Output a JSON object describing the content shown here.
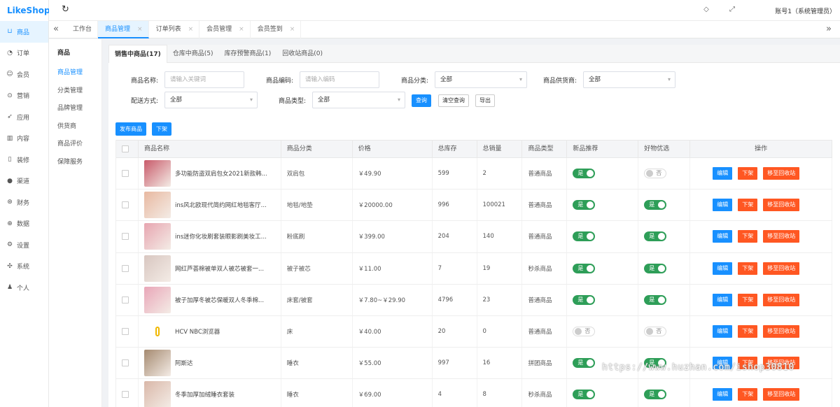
{
  "app": {
    "logo": "LikeShop"
  },
  "topbar": {
    "account": "账号1（系统管理员）"
  },
  "nav": [
    {
      "label": "商品",
      "icon": "cart-icon",
      "active": true
    },
    {
      "label": "订单",
      "icon": "bell-icon"
    },
    {
      "label": "会员",
      "icon": "user-icon"
    },
    {
      "label": "营销",
      "icon": "marketing-icon"
    },
    {
      "label": "应用",
      "icon": "send-icon"
    },
    {
      "label": "内容",
      "icon": "book-icon"
    },
    {
      "label": "装修",
      "icon": "phone-icon"
    },
    {
      "label": "渠道",
      "icon": "channel-icon"
    },
    {
      "label": "财务",
      "icon": "finance-icon"
    },
    {
      "label": "数据",
      "icon": "data-icon"
    },
    {
      "label": "设置",
      "icon": "settings-icon"
    },
    {
      "label": "系统",
      "icon": "system-icon"
    },
    {
      "label": "个人",
      "icon": "person-icon"
    }
  ],
  "tabs": [
    {
      "label": "工作台",
      "closable": false
    },
    {
      "label": "商品管理",
      "closable": true,
      "active": true
    },
    {
      "label": "订单列表",
      "closable": true
    },
    {
      "label": "会员管理",
      "closable": true
    },
    {
      "label": "会员签到",
      "closable": true
    }
  ],
  "subnav": {
    "title": "商品",
    "items": [
      "商品管理",
      "分类管理",
      "品牌管理",
      "供货商",
      "商品评价",
      "保障服务"
    ]
  },
  "content_tabs": [
    "销售中商品(17)",
    "仓库中商品(5)",
    "库存预警商品(1)",
    "回收站商品(0)"
  ],
  "filters": {
    "name_label": "商品名称:",
    "name_placeholder": "请输入关键词",
    "code_label": "商品编码:",
    "code_placeholder": "请输入编码",
    "category_label": "商品分类:",
    "category_value": "全部",
    "supplier_label": "商品供货商:",
    "supplier_value": "全部",
    "delivery_label": "配送方式:",
    "delivery_value": "全部",
    "type_label": "商品类型:",
    "type_value": "全部",
    "search_btn": "查询",
    "clear_btn": "清空查询",
    "export_btn": "导出"
  },
  "actions": {
    "publish": "发布商品",
    "offshelf": "下架"
  },
  "table": {
    "headers": [
      "商品名称",
      "商品分类",
      "价格",
      "总库存",
      "总销量",
      "商品类型",
      "新品推荐",
      "好物优选",
      "操作"
    ],
    "rows": [
      {
        "name": "多功能防盗双肩包女2021新款韩...",
        "category": "双肩包",
        "price": "￥49.90",
        "stock": "599",
        "sales": "2",
        "type": "普通商品",
        "new_rec": "是",
        "new_on": true,
        "pick": "否",
        "pick_on": false,
        "thumb_color": "#c85a6a"
      },
      {
        "name": "ins风北欧现代简约网红地毯客厅...",
        "category": "地毯/地垫",
        "price": "￥20000.00",
        "stock": "996",
        "sales": "100021",
        "type": "普通商品",
        "new_rec": "是",
        "new_on": true,
        "pick": "是",
        "pick_on": true,
        "thumb_color": "#e8b8a0"
      },
      {
        "name": "ins迷你化妆刷套装眼影刷美妆工...",
        "category": "粉底刷",
        "price": "￥399.00",
        "stock": "204",
        "sales": "140",
        "type": "普通商品",
        "new_rec": "是",
        "new_on": true,
        "pick": "是",
        "pick_on": true,
        "thumb_color": "#e7a5b0"
      },
      {
        "name": "网红芦荟棉被单双人被芯被套一...",
        "category": "被子被芯",
        "price": "￥11.00",
        "stock": "7",
        "sales": "19",
        "type": "秒杀商品",
        "new_rec": "是",
        "new_on": true,
        "pick": "是",
        "pick_on": true,
        "thumb_color": "#d8c6c0"
      },
      {
        "name": "被子加厚冬被芯保暖双人冬季棉...",
        "category": "床套/被套",
        "price": "￥7.80~￥29.90",
        "stock": "4796",
        "sales": "23",
        "type": "普通商品",
        "new_rec": "是",
        "new_on": true,
        "pick": "是",
        "pick_on": true,
        "thumb_color": "#e9a6b8"
      },
      {
        "name": "HCV NBC浏览器",
        "category": "床",
        "price": "￥40.00",
        "stock": "20",
        "sales": "0",
        "type": "普通商品",
        "new_rec": "否",
        "new_on": false,
        "pick": "否",
        "pick_on": false,
        "thumb_color": "#ffffff"
      },
      {
        "name": "阿斯达",
        "category": "睡衣",
        "price": "￥55.00",
        "stock": "997",
        "sales": "16",
        "type": "拼团商品",
        "new_rec": "是",
        "new_on": true,
        "pick": "是",
        "pick_on": true,
        "thumb_color": "#a58a70"
      },
      {
        "name": "冬季加厚加绒睡衣套装",
        "category": "睡衣",
        "price": "￥69.00",
        "stock": "4",
        "sales": "8",
        "type": "秒杀商品",
        "new_rec": "是",
        "new_on": true,
        "pick": "是",
        "pick_on": true,
        "thumb_color": "#d9b7a8"
      }
    ],
    "op_edit": "编辑",
    "op_down": "下架",
    "op_recycle": "移至回收站"
  },
  "watermark": "https://www.huzhan.com/ishop30810"
}
